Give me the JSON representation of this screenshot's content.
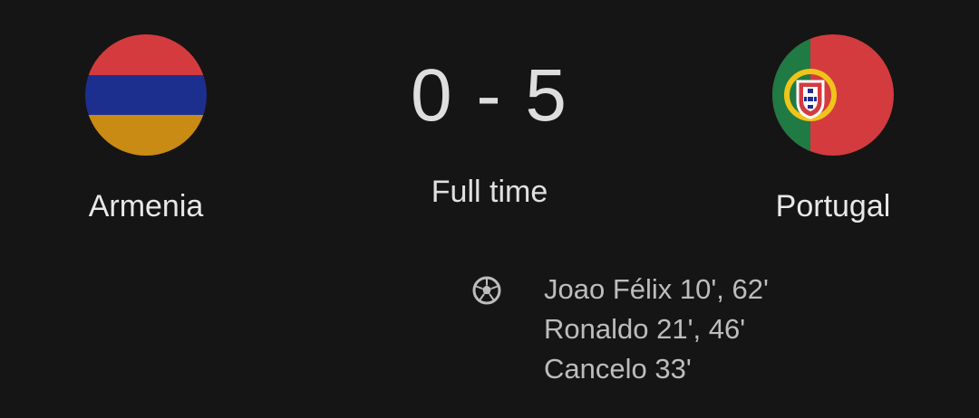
{
  "match": {
    "home": {
      "name": "Armenia",
      "flag_icon": "armenia-flag-icon",
      "flag_colors": [
        "#d33b3f",
        "#1d2f8e",
        "#c98b14"
      ]
    },
    "away": {
      "name": "Portugal",
      "flag_icon": "portugal-flag-icon",
      "flag_colors": [
        "#1f7a43",
        "#d33b3f",
        "#f0c419"
      ]
    },
    "score": "0 - 5",
    "status": "Full time"
  },
  "scorers": {
    "icon": "soccer-ball-icon",
    "lines": [
      "Joao Félix 10', 62'",
      "Ronaldo 21', 46'",
      "Cancelo 33'"
    ]
  }
}
